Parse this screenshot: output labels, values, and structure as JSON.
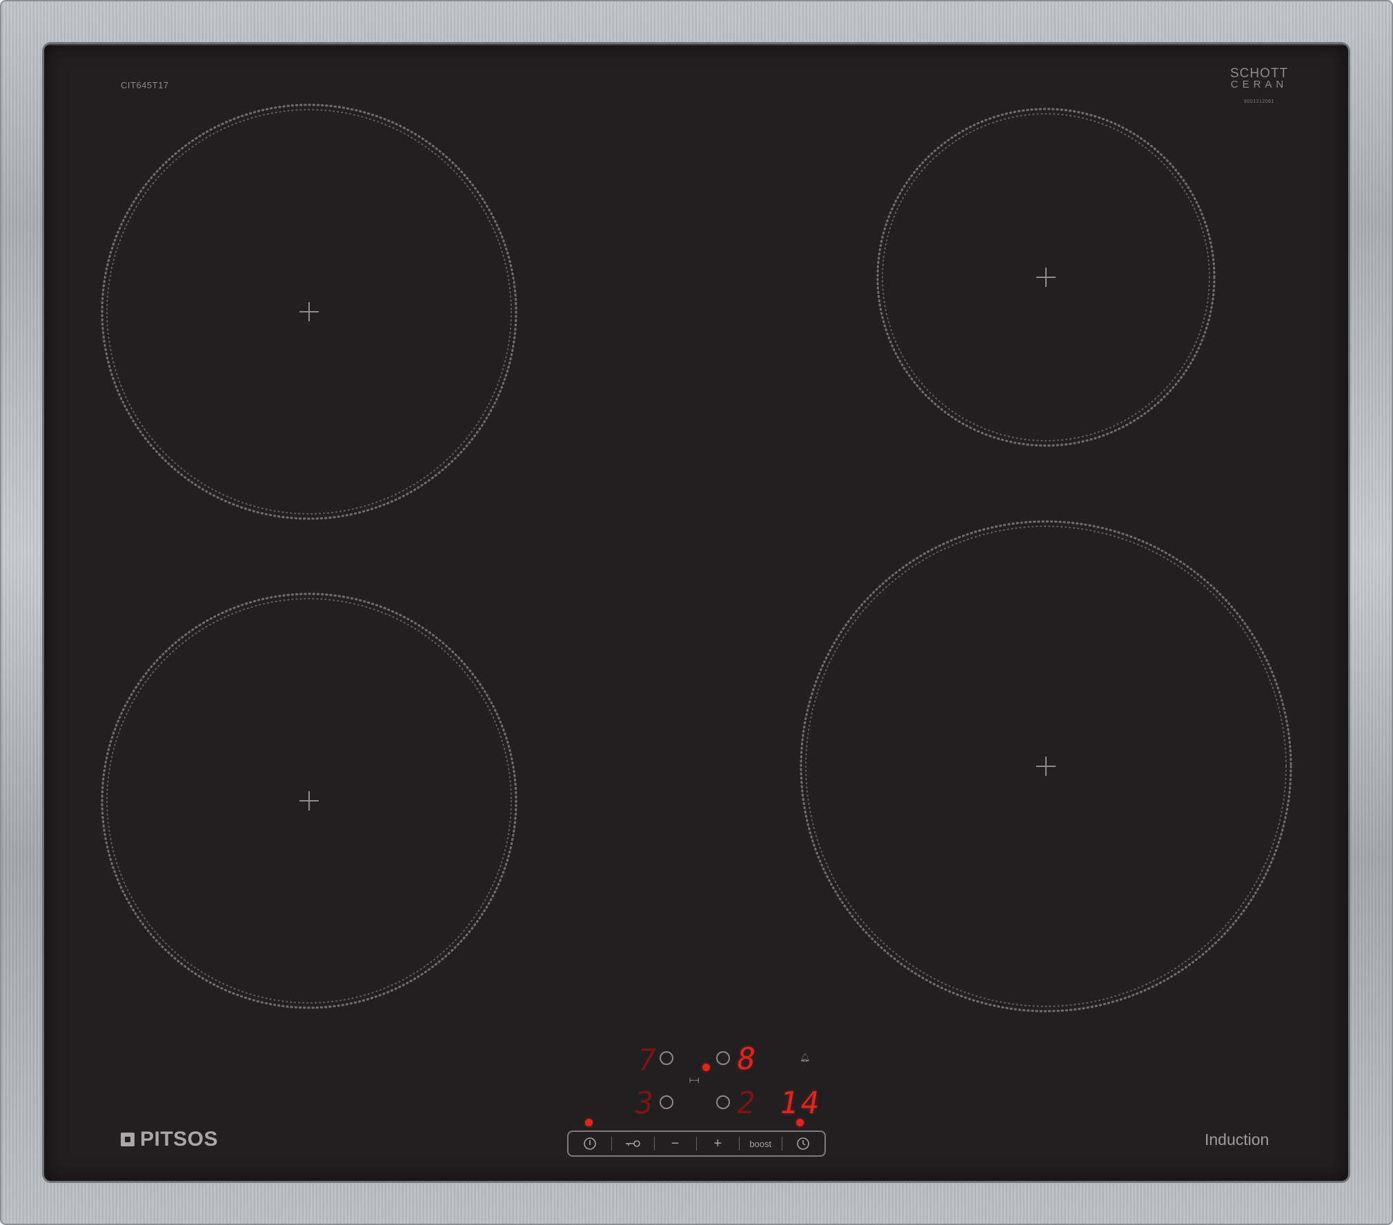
{
  "hob": {
    "model_code": "CIT645T17",
    "glass_brand_line1": "SCHOTT",
    "glass_brand_line2": "CERAN",
    "glass_serial": "8001212061",
    "brand_name": "PITSOS",
    "type_label": "Induction"
  },
  "zones": [
    {
      "id": "rear-left",
      "name": "cooking-zone-rear-left"
    },
    {
      "id": "rear-right",
      "name": "cooking-zone-rear-right"
    },
    {
      "id": "front-left",
      "name": "cooking-zone-front-left"
    },
    {
      "id": "front-right",
      "name": "cooking-zone-front-right"
    }
  ],
  "display": {
    "rear_left_level": "7",
    "rear_right_level": "8",
    "front_left_level": "3",
    "front_right_level": "2",
    "timer_value": "14"
  },
  "controls": {
    "power_icon": "power-icon",
    "lock_icon": "child-lock-key-icon",
    "minus_label": "−",
    "plus_label": "+",
    "boost_label": "boost",
    "timer_icon": "clock-icon"
  },
  "colors": {
    "glass": "#221f20",
    "display_red": "#e3241d",
    "marking_grey": "#8b8989"
  }
}
